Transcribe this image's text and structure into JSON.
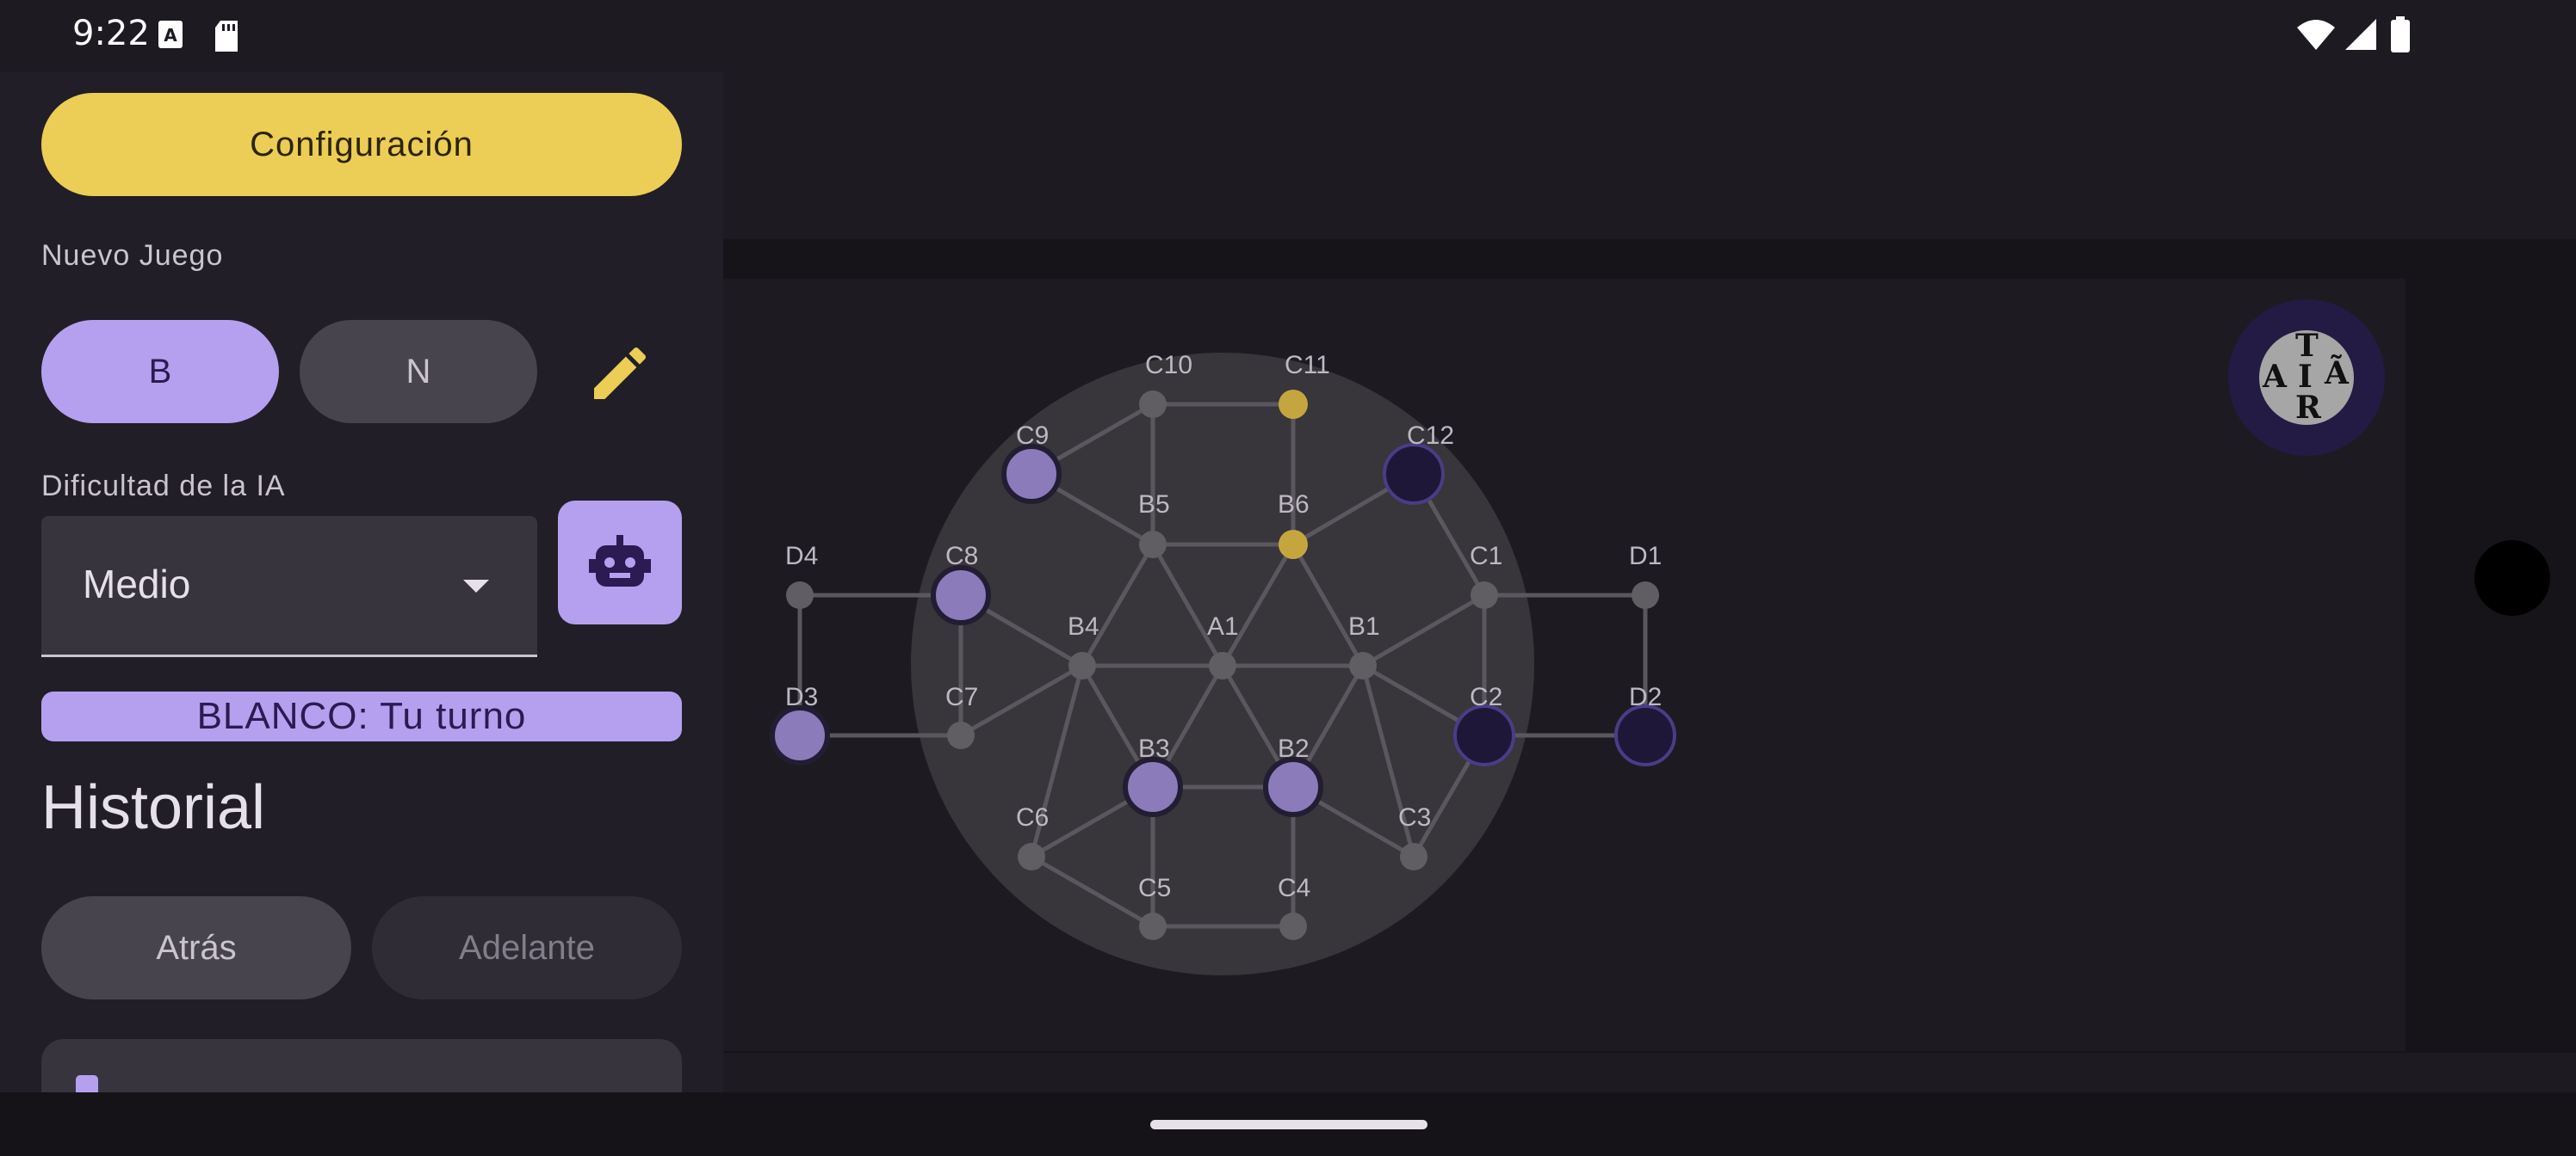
{
  "status_bar": {
    "time": "9:22"
  },
  "drawer": {
    "config_button": "Configuración",
    "new_game_label": "Nuevo Juego",
    "color_options": [
      "B",
      "N"
    ],
    "ai_difficulty_label": "Dificultad de la IA",
    "ai_difficulty_value": "Medio",
    "turn_banner": "BLANCO: Tu turno",
    "history_title": "Historial",
    "back_button": "Atrás",
    "forward_button": "Adelante"
  },
  "logo": {
    "letters": [
      "T",
      "A",
      "I",
      "Ã",
      "R"
    ]
  },
  "colors": {
    "accent": "#b5a0ef",
    "config": "#eccd55",
    "highlight_node": "#c5a63e",
    "player_white": "#8b7bba",
    "player_black": "#1e1738"
  },
  "board": {
    "nodes": [
      {
        "id": "A1",
        "label": "A1",
        "state": "empty"
      },
      {
        "id": "B1",
        "label": "B1",
        "state": "empty"
      },
      {
        "id": "B2",
        "label": "B2",
        "state": "white"
      },
      {
        "id": "B3",
        "label": "B3",
        "state": "white"
      },
      {
        "id": "B4",
        "label": "B4",
        "state": "empty"
      },
      {
        "id": "B5",
        "label": "B5",
        "state": "empty"
      },
      {
        "id": "B6",
        "label": "B6",
        "state": "highlight"
      },
      {
        "id": "C1",
        "label": "C1",
        "state": "empty"
      },
      {
        "id": "C2",
        "label": "C2",
        "state": "black"
      },
      {
        "id": "C3",
        "label": "C3",
        "state": "empty"
      },
      {
        "id": "C4",
        "label": "C4",
        "state": "empty"
      },
      {
        "id": "C5",
        "label": "C5",
        "state": "empty"
      },
      {
        "id": "C6",
        "label": "C6",
        "state": "empty"
      },
      {
        "id": "C7",
        "label": "C7",
        "state": "empty"
      },
      {
        "id": "C8",
        "label": "C8",
        "state": "white"
      },
      {
        "id": "C9",
        "label": "C9",
        "state": "white"
      },
      {
        "id": "C10",
        "label": "C10",
        "state": "empty"
      },
      {
        "id": "C11",
        "label": "C11",
        "state": "highlight"
      },
      {
        "id": "C12",
        "label": "C12",
        "state": "black"
      },
      {
        "id": "D1",
        "label": "D1",
        "state": "empty"
      },
      {
        "id": "D2",
        "label": "D2",
        "state": "black"
      },
      {
        "id": "D3",
        "label": "D3",
        "state": "white"
      },
      {
        "id": "D4",
        "label": "D4",
        "state": "empty"
      }
    ],
    "edges": [
      [
        "A1",
        "B1"
      ],
      [
        "A1",
        "B2"
      ],
      [
        "A1",
        "B3"
      ],
      [
        "A1",
        "B4"
      ],
      [
        "A1",
        "B5"
      ],
      [
        "A1",
        "B6"
      ],
      [
        "B1",
        "B2"
      ],
      [
        "B2",
        "B3"
      ],
      [
        "B3",
        "B4"
      ],
      [
        "B4",
        "B5"
      ],
      [
        "B5",
        "B6"
      ],
      [
        "B6",
        "B1"
      ],
      [
        "B1",
        "C1"
      ],
      [
        "B1",
        "C2"
      ],
      [
        "B1",
        "C3"
      ],
      [
        "B2",
        "C3"
      ],
      [
        "B2",
        "C4"
      ],
      [
        "B3",
        "C5"
      ],
      [
        "B3",
        "C6"
      ],
      [
        "B4",
        "C6"
      ],
      [
        "B4",
        "C7"
      ],
      [
        "B4",
        "C8"
      ],
      [
        "B5",
        "C9"
      ],
      [
        "B5",
        "C10"
      ],
      [
        "B6",
        "C11"
      ],
      [
        "B6",
        "C12"
      ],
      [
        "C1",
        "C2"
      ],
      [
        "C2",
        "C3"
      ],
      [
        "C4",
        "C5"
      ],
      [
        "C5",
        "C6"
      ],
      [
        "C7",
        "C8"
      ],
      [
        "C9",
        "C10"
      ],
      [
        "C10",
        "C11"
      ],
      [
        "C12",
        "C1"
      ],
      [
        "C1",
        "D1"
      ],
      [
        "D1",
        "D2"
      ],
      [
        "D2",
        "C2"
      ],
      [
        "C8",
        "D4"
      ],
      [
        "D4",
        "D3"
      ],
      [
        "D3",
        "C7"
      ]
    ]
  }
}
